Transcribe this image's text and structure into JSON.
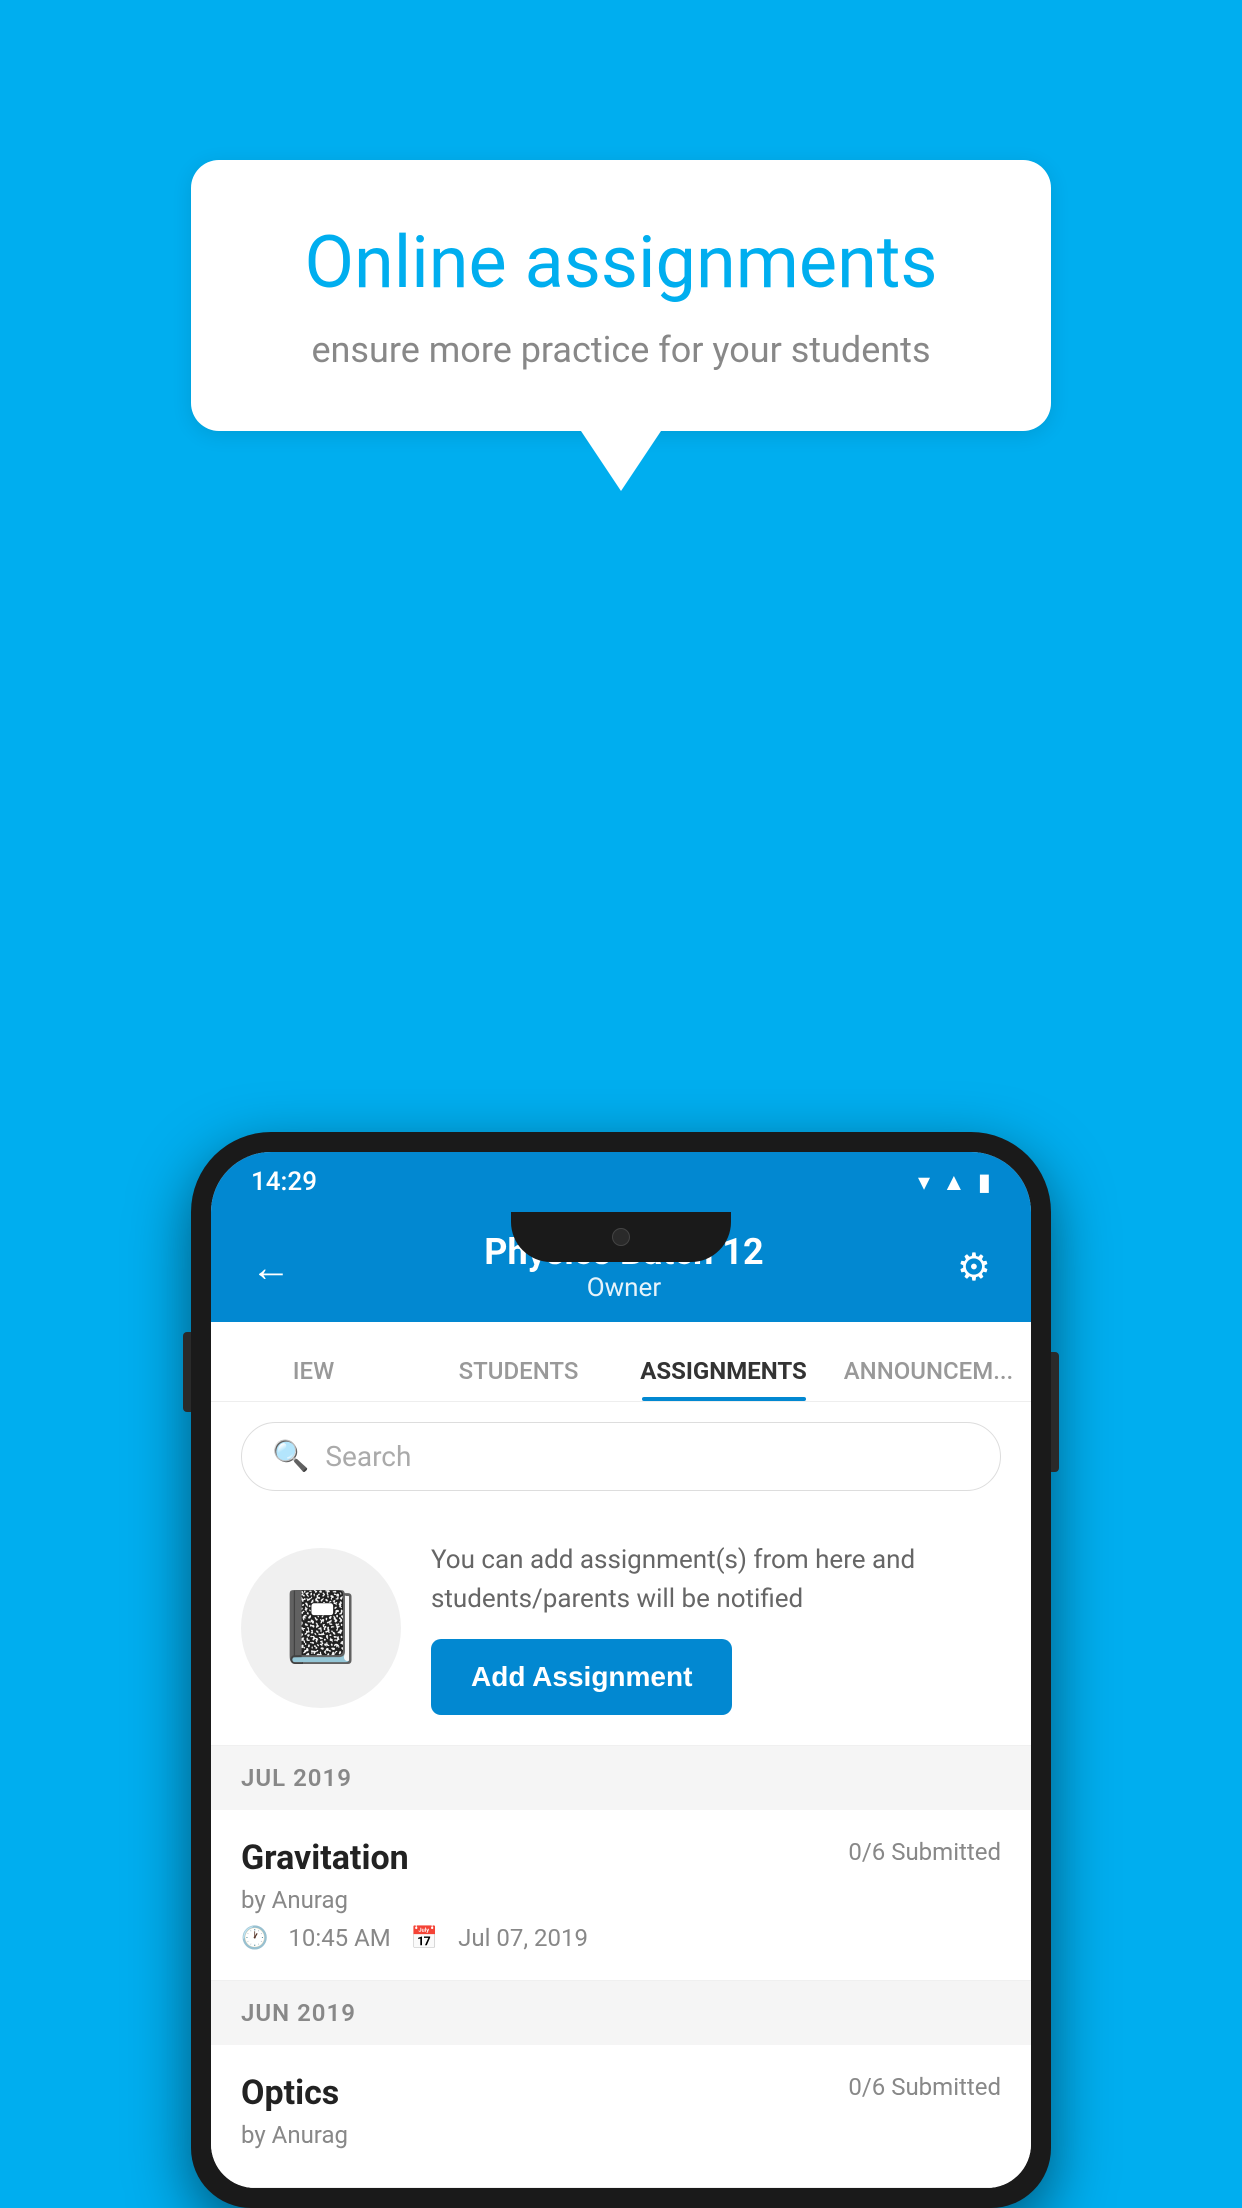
{
  "background_color": "#00AEEF",
  "speech_bubble": {
    "title": "Online assignments",
    "subtitle": "ensure more practice for your students"
  },
  "status_bar": {
    "time": "14:29",
    "icons": [
      "wifi",
      "signal",
      "battery"
    ]
  },
  "header": {
    "title": "Physics Batch 12",
    "subtitle": "Owner",
    "back_label": "←",
    "settings_label": "⚙"
  },
  "tabs": [
    {
      "label": "IEW",
      "active": false
    },
    {
      "label": "STUDENTS",
      "active": false
    },
    {
      "label": "ASSIGNMENTS",
      "active": true
    },
    {
      "label": "ANNOUNCEM...",
      "active": false
    }
  ],
  "search": {
    "placeholder": "Search"
  },
  "info_section": {
    "description": "You can add assignment(s) from here and students/parents will be notified",
    "add_button_label": "Add Assignment"
  },
  "sections": [
    {
      "label": "JUL 2019",
      "assignments": [
        {
          "name": "Gravitation",
          "submitted": "0/6 Submitted",
          "author": "by Anurag",
          "time": "10:45 AM",
          "date": "Jul 07, 2019"
        }
      ]
    },
    {
      "label": "JUN 2019",
      "assignments": [
        {
          "name": "Optics",
          "submitted": "0/6 Submitted",
          "author": "by Anurag",
          "time": "",
          "date": ""
        }
      ]
    }
  ]
}
